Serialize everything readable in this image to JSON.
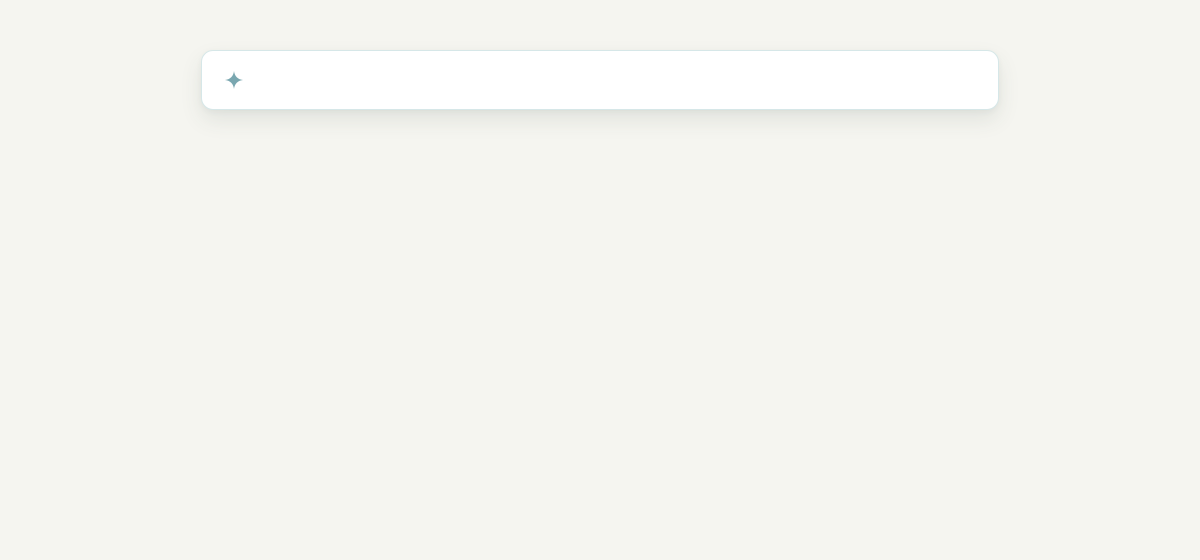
{
  "prompt": {
    "icon": "sparkle-icon",
    "icon_color": "#7aa7b0",
    "value": "",
    "placeholder": ""
  },
  "colors": {
    "background": "#f5f5f0",
    "card": "#ffffff",
    "card_border": "#d6e7e8"
  }
}
